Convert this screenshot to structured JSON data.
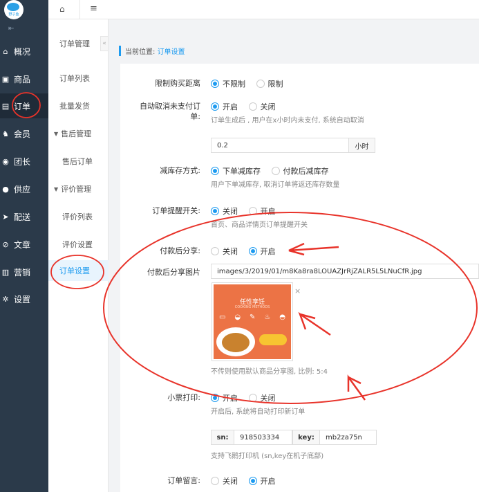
{
  "sidebar": {
    "logo_text": "野子鱼",
    "collapse_icon": "indent-icon",
    "items": [
      {
        "label": "概况",
        "icon": "home-icon"
      },
      {
        "label": "商品",
        "icon": "goods-icon"
      },
      {
        "label": "订单",
        "icon": "order-icon"
      },
      {
        "label": "会员",
        "icon": "member-icon"
      },
      {
        "label": "团长",
        "icon": "leader-icon"
      },
      {
        "label": "供应",
        "icon": "supply-icon"
      },
      {
        "label": "配送",
        "icon": "delivery-icon"
      },
      {
        "label": "文章",
        "icon": "article-icon"
      },
      {
        "label": "营销",
        "icon": "marketing-icon"
      },
      {
        "label": "设置",
        "icon": "gear-icon"
      }
    ]
  },
  "submenu": {
    "title": "订单管理",
    "items": [
      {
        "label": "订单列表"
      },
      {
        "label": "批量发货"
      },
      {
        "label": "售后管理"
      },
      {
        "label": "售后订单"
      },
      {
        "label": "评价管理"
      },
      {
        "label": "评价列表"
      },
      {
        "label": "评价设置"
      },
      {
        "label": "订单设置"
      }
    ]
  },
  "breadcrumb": {
    "prefix": "当前位置:",
    "current": "订单设置"
  },
  "form": {
    "limit_distance": {
      "label": "限制购买距离",
      "opt1": "不限制",
      "opt2": "限制"
    },
    "auto_cancel": {
      "label_line1": "自动取消未支付订",
      "label_line2": "单:",
      "opt1": "开启",
      "opt2": "关闭",
      "hint": "订单生成后 , 用户在x小时内未支付, 系统自动取消",
      "value": "0.2",
      "unit": "小时"
    },
    "stock_mode": {
      "label": "减库存方式:",
      "opt1": "下单减库存",
      "opt2": "付款后减库存",
      "hint": "用户下单减库存, 取消订单将返还库存数量"
    },
    "order_remind": {
      "label": "订单提醒开关:",
      "opt1": "关闭",
      "opt2": "开启",
      "hint": "首页、商品详情页订单提醒开关"
    },
    "pay_share": {
      "label": "付款后分享:",
      "opt1": "关闭",
      "opt2": "开启"
    },
    "pay_share_image": {
      "label": "付款后分享图片",
      "path": "images/3/2019/01/m8Ka8ra8LOUAZJrRjZALR5L5LNuCfR.jpg",
      "hint": "不传则使用默认商品分享图, 比例: 5:4",
      "poster_title": "任性享饪",
      "poster_sub": "COOKING METHODS",
      "close": "×"
    },
    "receipt_print": {
      "label": "小票打印:",
      "opt1": "开启",
      "opt2": "关闭",
      "hint": "开启后, 系统将自动打印新订单",
      "sn_label": "sn:",
      "sn_value": "918503334",
      "key_label": "key:",
      "key_value": "mb2za75n",
      "hint2": "支持飞鹅打印机 (sn,key在机子底部)"
    },
    "order_message": {
      "label": "订单留言:",
      "opt1": "关闭",
      "opt2": "开启"
    }
  },
  "colors": {
    "accent": "#1d9bf0",
    "annotation": "#e8332a",
    "sidebar": "#2b3a4a"
  }
}
